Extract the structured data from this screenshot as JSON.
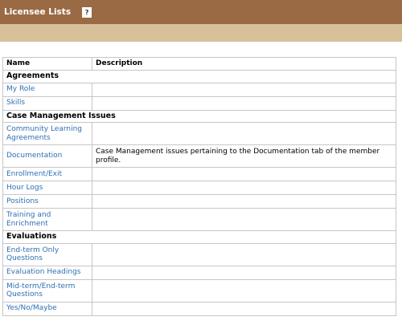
{
  "header": {
    "title": "Licensee Lists",
    "help_icon": "?"
  },
  "table": {
    "columns": [
      "Name",
      "Description"
    ],
    "groups": [
      {
        "label": "Agreements",
        "items": [
          {
            "name": "My Role",
            "description": ""
          },
          {
            "name": "Skills",
            "description": ""
          }
        ]
      },
      {
        "label": "Case Management Issues",
        "items": [
          {
            "name": "Community Learning Agreements",
            "description": ""
          },
          {
            "name": "Documentation",
            "description": "Case Management issues pertaining to the Documentation tab of the member profile."
          },
          {
            "name": "Enrollment/Exit",
            "description": ""
          },
          {
            "name": "Hour Logs",
            "description": ""
          },
          {
            "name": "Positions",
            "description": ""
          },
          {
            "name": "Training and Enrichment",
            "description": ""
          }
        ]
      },
      {
        "label": "Evaluations",
        "items": [
          {
            "name": "End-term Only Questions",
            "description": ""
          },
          {
            "name": "Evaluation Headings",
            "description": ""
          },
          {
            "name": "Mid-term/End-term Questions",
            "description": ""
          },
          {
            "name": "Yes/No/Maybe",
            "description": ""
          }
        ]
      }
    ]
  }
}
